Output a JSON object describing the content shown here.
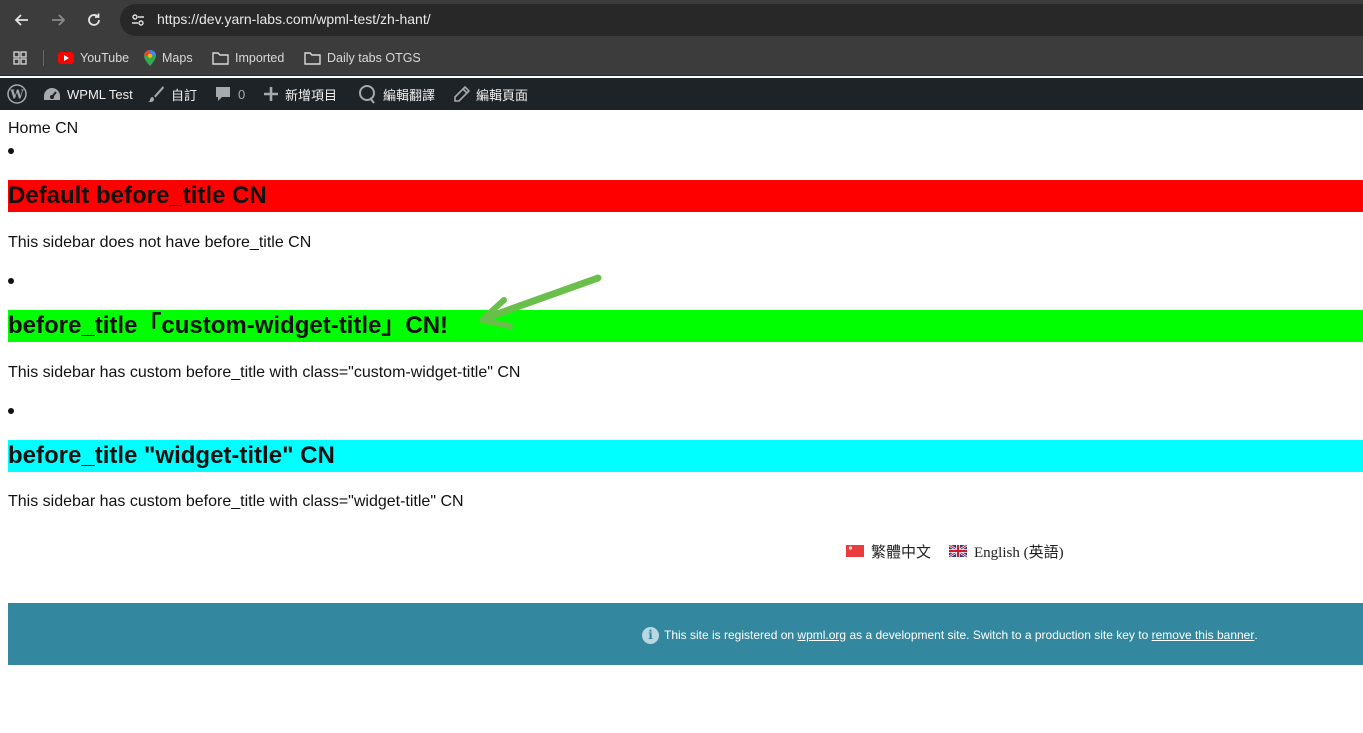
{
  "browser": {
    "url": "https://dev.yarn-labs.com/wpml-test/zh-hant/",
    "bookmarks": [
      {
        "label": "YouTube",
        "icon": "youtube-icon"
      },
      {
        "label": "Maps",
        "icon": "maps-pin-icon"
      },
      {
        "label": "Imported",
        "icon": "folder-icon"
      },
      {
        "label": "Daily tabs OTGS",
        "icon": "folder-icon"
      }
    ]
  },
  "adminbar": {
    "site_name": "WPML Test",
    "customize": "自訂",
    "comments_count": "0",
    "new_item": "新增項目",
    "edit_translation": "編輯翻譯",
    "edit_page": "編輯頁面"
  },
  "page": {
    "home_title": "Home CN",
    "widgets": [
      {
        "title": "Default before_title CN",
        "text": "This sidebar does not have before_title CN",
        "bg": "#ff0000"
      },
      {
        "title": "before_title「custom-widget-title」CN!",
        "text": "This sidebar has custom before_title with class=\"custom-widget-title\" CN",
        "bg": "#00ff00"
      },
      {
        "title": "before_title \"widget-title\" CN",
        "text": "This sidebar has custom before_title with class=\"widget-title\" CN",
        "bg": "#00ffff"
      }
    ],
    "arrow_color": "#6abf4b"
  },
  "language_switcher": {
    "items": [
      {
        "label": "繁體中文",
        "flag": "flag-taiwan-icon"
      },
      {
        "label": "English (英語)",
        "flag": "flag-uk-icon"
      }
    ]
  },
  "dev_banner": {
    "prefix": "This site is registered on",
    "link1": "wpml.org",
    "middle": "as a development site. Switch to a production site key to",
    "link2": "remove this banner",
    "suffix": ".",
    "bg": "#33879e"
  }
}
